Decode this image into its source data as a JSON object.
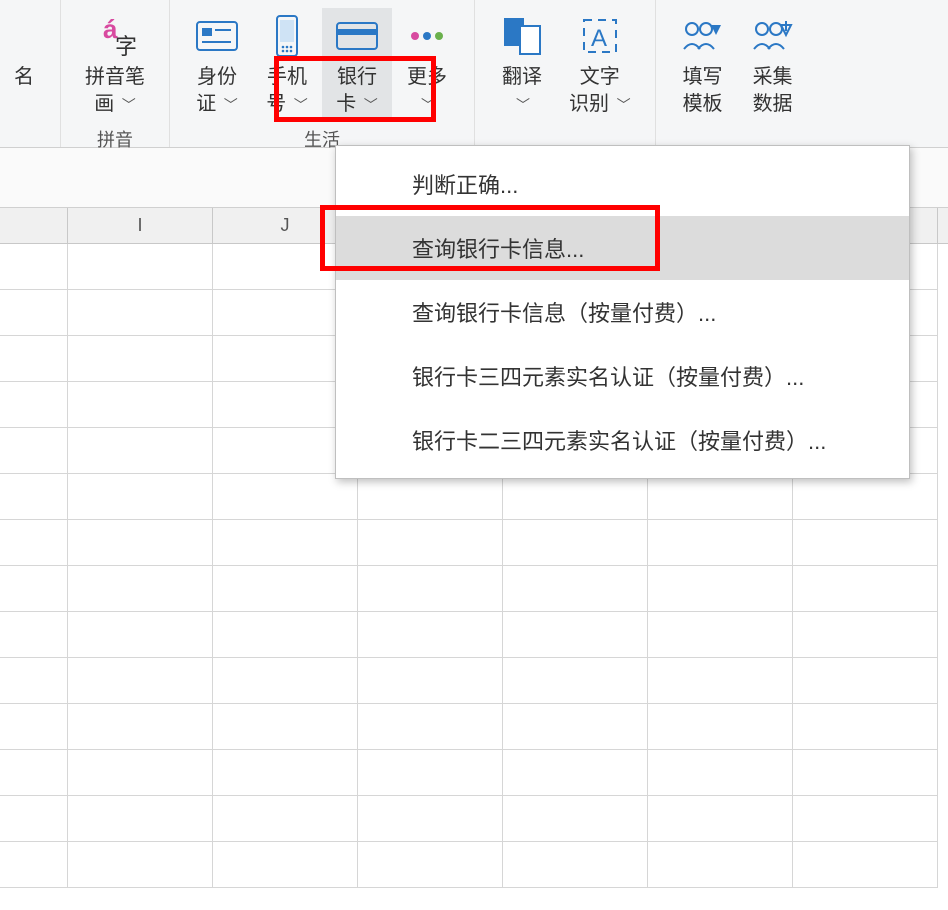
{
  "ribbon": {
    "groups": [
      {
        "title": "拼音",
        "items": [
          {
            "label": "拼音笔\n画 ",
            "icon": "pinyin-icon",
            "has_caret": true
          }
        ]
      },
      {
        "title": "生活",
        "items": [
          {
            "label": "身份\n证 ",
            "icon": "id-card-icon",
            "has_caret": true
          },
          {
            "label": "手机\n号 ",
            "icon": "phone-icon",
            "has_caret": true
          },
          {
            "label": "银行\n卡 ",
            "icon": "bank-card-icon",
            "has_caret": true,
            "active": true
          },
          {
            "label": "更多\n ",
            "icon": "more-icon",
            "has_caret": true
          }
        ]
      },
      {
        "title": "",
        "items": [
          {
            "label": "翻译\n ",
            "icon": "translate-icon",
            "has_caret": true
          },
          {
            "label": "文字\n识别 ",
            "icon": "ocr-icon",
            "has_caret": true
          }
        ]
      },
      {
        "title": "",
        "items": [
          {
            "label": "填写\n模板",
            "icon": "template-icon",
            "has_caret": false
          },
          {
            "label": "采集\n数据",
            "icon": "collect-icon",
            "has_caret": false
          }
        ]
      }
    ]
  },
  "menu": {
    "items": [
      {
        "label": "判断正确..."
      },
      {
        "label": "查询银行卡信息...",
        "hovered": true
      },
      {
        "label": "查询银行卡信息（按量付费）..."
      },
      {
        "label": "银行卡三四元素实名认证（按量付费）..."
      },
      {
        "label": "银行卡二三四元素实名认证（按量付费）..."
      }
    ]
  },
  "columns": [
    "",
    "I",
    "J",
    "",
    "",
    "",
    ""
  ],
  "char": {
    "zi": "字",
    "a_accent": "á"
  }
}
